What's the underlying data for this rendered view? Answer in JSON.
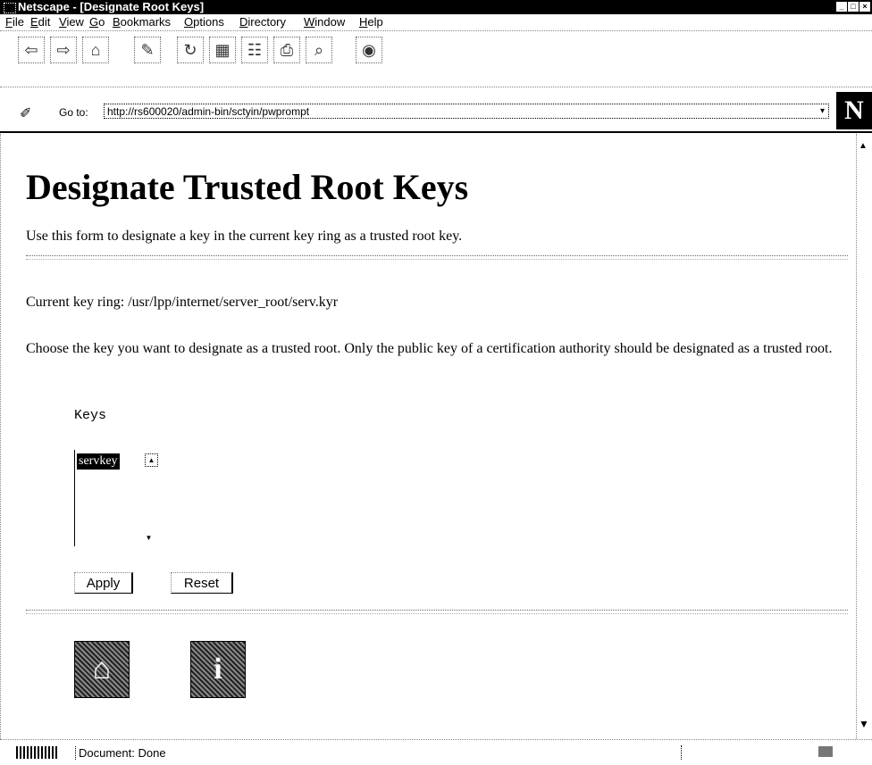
{
  "window": {
    "title": "Netscape - [Designate Root Keys]"
  },
  "menu": [
    "File",
    "Edit",
    "View",
    "Go",
    "Bookmarks",
    "Options",
    "Directory",
    "Window",
    "Help"
  ],
  "toolbar_icons": [
    "back-icon",
    "forward-icon",
    "home-icon",
    "edit-icon",
    "reload-icon",
    "images-icon",
    "open-icon",
    "print-icon",
    "find-icon",
    "stop-icon"
  ],
  "location": {
    "label": "Go to:",
    "url": "http://rs600020/admin-bin/sctyin/pwprompt"
  },
  "logo": "N",
  "page": {
    "heading": "Designate Trusted Root Keys",
    "intro": "Use this form to designate a key in the current key ring as a trusted root key.",
    "current_ring": "Current key ring: /usr/lpp/internet/server_root/serv.kyr",
    "instructions": "Choose the key you want to designate as a trusted root. Only the public key of a certification authority should be designated as a trusted root.",
    "keys_label": "Keys",
    "keys_selected": "servkey",
    "apply_label": "Apply",
    "reset_label": "Reset"
  },
  "status": {
    "text": "Document: Done"
  }
}
